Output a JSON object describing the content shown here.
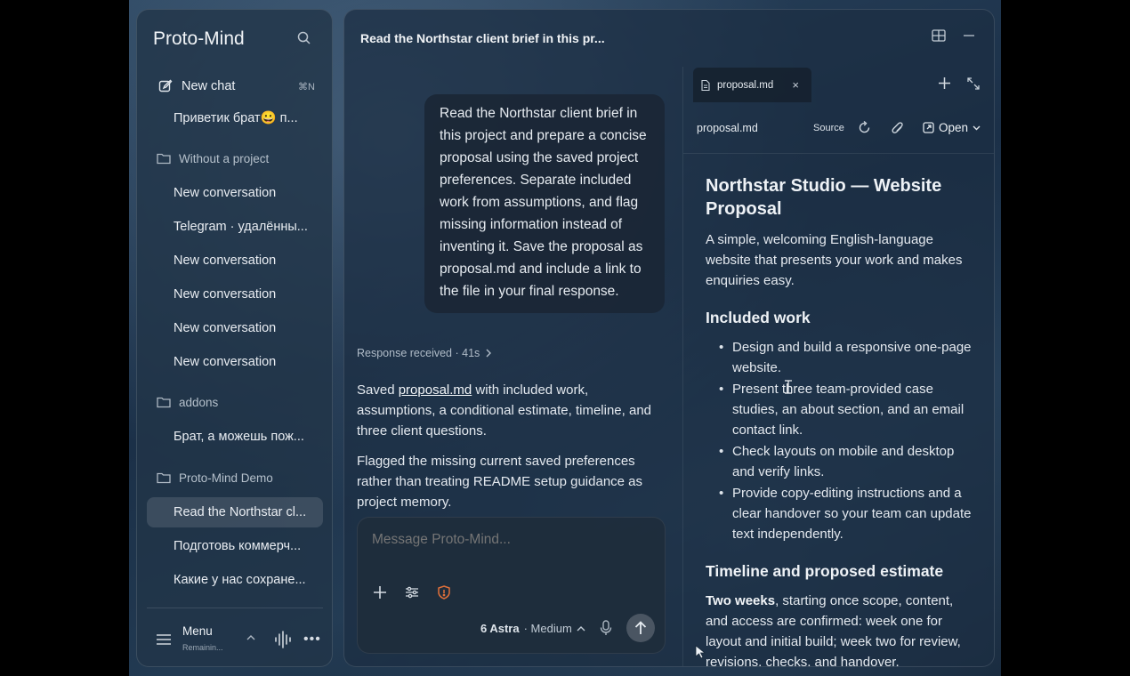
{
  "app": {
    "title": "Proto-Mind"
  },
  "sidebar": {
    "new_chat_label": "New chat",
    "new_chat_shortcut": "⌘N",
    "pinned_chat": "Приветик брат😀 п...",
    "groups": [
      {
        "label": "Without a project",
        "items": [
          "New conversation",
          "Telegram · удалённы...",
          "New conversation",
          "New conversation",
          "New conversation",
          "New conversation"
        ]
      },
      {
        "label": "addons",
        "items": [
          "Брат, а можешь пож..."
        ]
      },
      {
        "label": "Proto-Mind Demo",
        "items": [
          "Read the Northstar cl...",
          "Подготовь коммерч...",
          "Какие у нас сохране..."
        ]
      }
    ],
    "footer": {
      "title": "Menu",
      "subtitle": "Remainin..."
    }
  },
  "main": {
    "title": "Read the Northstar client brief in this pr...",
    "user_message": "Read the Northstar client brief in this project and prepare a concise proposal using the saved project preferences. Separate included work from assumptions, and flag missing information instead of inventing it. Save the proposal as proposal.md and include a link to the file in your final response.",
    "response_meta": "Response received · 41s",
    "response": {
      "p1_prefix": "Saved ",
      "p1_link": "proposal.md",
      "p1_suffix": " with included work, assumptions, a conditional estimate, timeline, and three client questions.",
      "p2": "Flagged the missing current saved preferences rather than treating README setup guidance as project memory."
    },
    "composer": {
      "placeholder": "Message Proto-Mind...",
      "model": "6 Astra",
      "effort": "· Medium"
    }
  },
  "preview": {
    "tab_label": "proposal.md",
    "file_name": "proposal.md",
    "source_label": "Source",
    "open_label": "Open",
    "doc": {
      "title": "Northstar Studio — Website Proposal",
      "intro": "A simple, welcoming English-language website that presents your work and makes enquiries easy.",
      "included_heading": "Included work",
      "included_items": [
        "Design and build a responsive one-page website.",
        "Present three team-provided case studies, an about section, and an email contact link.",
        "Check layouts on mobile and desktop and verify links.",
        "Provide copy-editing instructions and a clear handover so your team can update text independently."
      ],
      "timeline_heading": "Timeline and proposed estimate",
      "timeline_bold": "Two weeks",
      "timeline_text": ", starting once scope, content, and access are confirmed: week one for layout and initial build; week two for review, revisions, checks, and handover."
    }
  },
  "colors": {
    "accent_shield": "#e0703a",
    "panel": "#1c2e42"
  }
}
